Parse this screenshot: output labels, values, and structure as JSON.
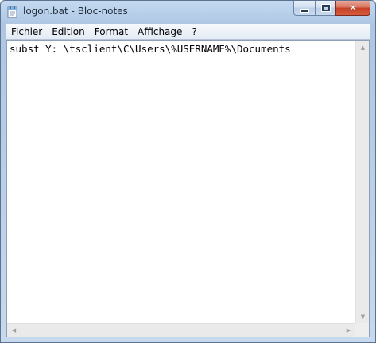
{
  "window": {
    "title": "logon.bat - Bloc-notes",
    "app_icon": "notepad-icon"
  },
  "caption_buttons": {
    "minimize_icon": "minimize-icon",
    "maximize_icon": "maximize-icon",
    "close_icon": "close-icon",
    "close_glyph": "✕"
  },
  "menu": {
    "items": [
      {
        "label": "Fichier"
      },
      {
        "label": "Edition"
      },
      {
        "label": "Format"
      },
      {
        "label": "Affichage"
      },
      {
        "label": "?"
      }
    ]
  },
  "editor": {
    "content": "subst Y: \\tsclient\\C\\Users\\%USERNAME%\\Documents"
  },
  "scrollbars": {
    "up_glyph": "▲",
    "down_glyph": "▼",
    "left_glyph": "◀",
    "right_glyph": "▶"
  }
}
